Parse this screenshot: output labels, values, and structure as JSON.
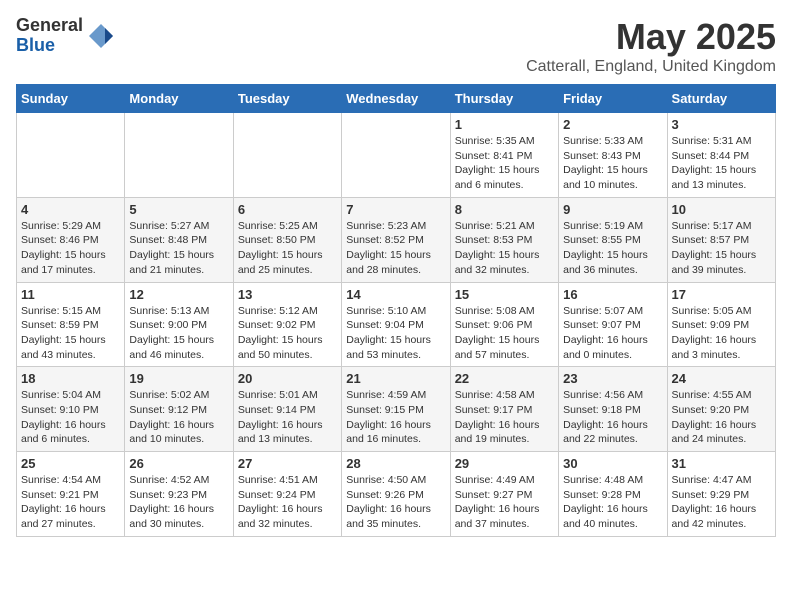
{
  "logo": {
    "general": "General",
    "blue": "Blue"
  },
  "title": "May 2025",
  "location": "Catterall, England, United Kingdom",
  "days_of_week": [
    "Sunday",
    "Monday",
    "Tuesday",
    "Wednesday",
    "Thursday",
    "Friday",
    "Saturday"
  ],
  "weeks": [
    [
      {
        "day": "",
        "info": ""
      },
      {
        "day": "",
        "info": ""
      },
      {
        "day": "",
        "info": ""
      },
      {
        "day": "",
        "info": ""
      },
      {
        "day": "1",
        "info": "Sunrise: 5:35 AM\nSunset: 8:41 PM\nDaylight: 15 hours\nand 6 minutes."
      },
      {
        "day": "2",
        "info": "Sunrise: 5:33 AM\nSunset: 8:43 PM\nDaylight: 15 hours\nand 10 minutes."
      },
      {
        "day": "3",
        "info": "Sunrise: 5:31 AM\nSunset: 8:44 PM\nDaylight: 15 hours\nand 13 minutes."
      }
    ],
    [
      {
        "day": "4",
        "info": "Sunrise: 5:29 AM\nSunset: 8:46 PM\nDaylight: 15 hours\nand 17 minutes."
      },
      {
        "day": "5",
        "info": "Sunrise: 5:27 AM\nSunset: 8:48 PM\nDaylight: 15 hours\nand 21 minutes."
      },
      {
        "day": "6",
        "info": "Sunrise: 5:25 AM\nSunset: 8:50 PM\nDaylight: 15 hours\nand 25 minutes."
      },
      {
        "day": "7",
        "info": "Sunrise: 5:23 AM\nSunset: 8:52 PM\nDaylight: 15 hours\nand 28 minutes."
      },
      {
        "day": "8",
        "info": "Sunrise: 5:21 AM\nSunset: 8:53 PM\nDaylight: 15 hours\nand 32 minutes."
      },
      {
        "day": "9",
        "info": "Sunrise: 5:19 AM\nSunset: 8:55 PM\nDaylight: 15 hours\nand 36 minutes."
      },
      {
        "day": "10",
        "info": "Sunrise: 5:17 AM\nSunset: 8:57 PM\nDaylight: 15 hours\nand 39 minutes."
      }
    ],
    [
      {
        "day": "11",
        "info": "Sunrise: 5:15 AM\nSunset: 8:59 PM\nDaylight: 15 hours\nand 43 minutes."
      },
      {
        "day": "12",
        "info": "Sunrise: 5:13 AM\nSunset: 9:00 PM\nDaylight: 15 hours\nand 46 minutes."
      },
      {
        "day": "13",
        "info": "Sunrise: 5:12 AM\nSunset: 9:02 PM\nDaylight: 15 hours\nand 50 minutes."
      },
      {
        "day": "14",
        "info": "Sunrise: 5:10 AM\nSunset: 9:04 PM\nDaylight: 15 hours\nand 53 minutes."
      },
      {
        "day": "15",
        "info": "Sunrise: 5:08 AM\nSunset: 9:06 PM\nDaylight: 15 hours\nand 57 minutes."
      },
      {
        "day": "16",
        "info": "Sunrise: 5:07 AM\nSunset: 9:07 PM\nDaylight: 16 hours\nand 0 minutes."
      },
      {
        "day": "17",
        "info": "Sunrise: 5:05 AM\nSunset: 9:09 PM\nDaylight: 16 hours\nand 3 minutes."
      }
    ],
    [
      {
        "day": "18",
        "info": "Sunrise: 5:04 AM\nSunset: 9:10 PM\nDaylight: 16 hours\nand 6 minutes."
      },
      {
        "day": "19",
        "info": "Sunrise: 5:02 AM\nSunset: 9:12 PM\nDaylight: 16 hours\nand 10 minutes."
      },
      {
        "day": "20",
        "info": "Sunrise: 5:01 AM\nSunset: 9:14 PM\nDaylight: 16 hours\nand 13 minutes."
      },
      {
        "day": "21",
        "info": "Sunrise: 4:59 AM\nSunset: 9:15 PM\nDaylight: 16 hours\nand 16 minutes."
      },
      {
        "day": "22",
        "info": "Sunrise: 4:58 AM\nSunset: 9:17 PM\nDaylight: 16 hours\nand 19 minutes."
      },
      {
        "day": "23",
        "info": "Sunrise: 4:56 AM\nSunset: 9:18 PM\nDaylight: 16 hours\nand 22 minutes."
      },
      {
        "day": "24",
        "info": "Sunrise: 4:55 AM\nSunset: 9:20 PM\nDaylight: 16 hours\nand 24 minutes."
      }
    ],
    [
      {
        "day": "25",
        "info": "Sunrise: 4:54 AM\nSunset: 9:21 PM\nDaylight: 16 hours\nand 27 minutes."
      },
      {
        "day": "26",
        "info": "Sunrise: 4:52 AM\nSunset: 9:23 PM\nDaylight: 16 hours\nand 30 minutes."
      },
      {
        "day": "27",
        "info": "Sunrise: 4:51 AM\nSunset: 9:24 PM\nDaylight: 16 hours\nand 32 minutes."
      },
      {
        "day": "28",
        "info": "Sunrise: 4:50 AM\nSunset: 9:26 PM\nDaylight: 16 hours\nand 35 minutes."
      },
      {
        "day": "29",
        "info": "Sunrise: 4:49 AM\nSunset: 9:27 PM\nDaylight: 16 hours\nand 37 minutes."
      },
      {
        "day": "30",
        "info": "Sunrise: 4:48 AM\nSunset: 9:28 PM\nDaylight: 16 hours\nand 40 minutes."
      },
      {
        "day": "31",
        "info": "Sunrise: 4:47 AM\nSunset: 9:29 PM\nDaylight: 16 hours\nand 42 minutes."
      }
    ]
  ]
}
